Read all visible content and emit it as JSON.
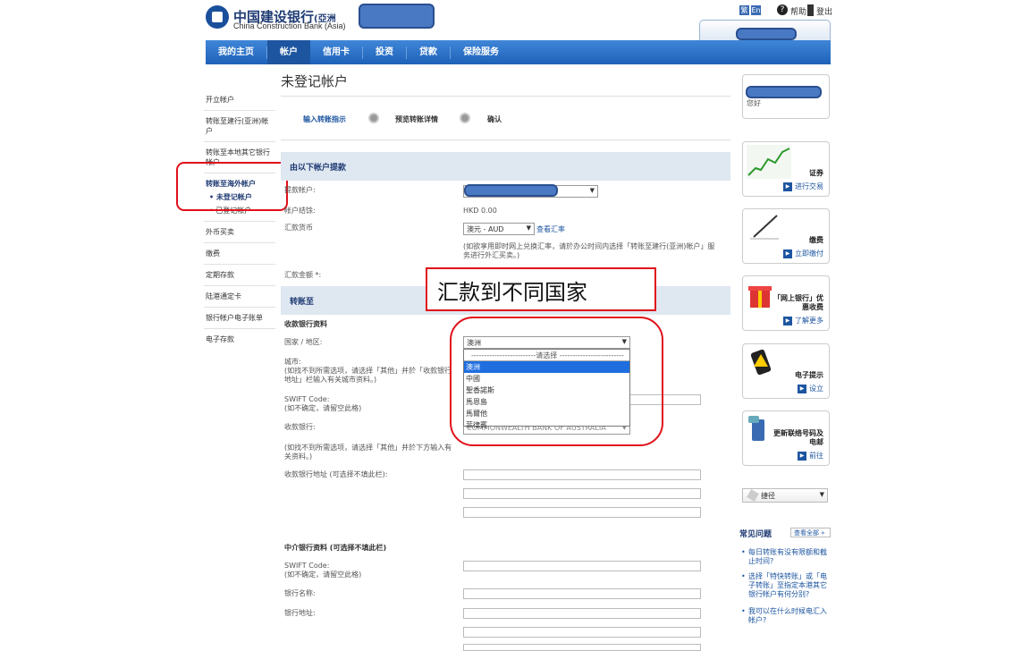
{
  "header": {
    "logo_cn": "中国建设银行",
    "logo_region": "(亞洲",
    "logo_en": "China Construction Bank (Asia)",
    "lang": [
      "繁",
      "En"
    ],
    "help": "帮助",
    "logout": "登出"
  },
  "nav": [
    "我的主页",
    "帐户",
    "信用卡",
    "投资",
    "贷款",
    "保险服务"
  ],
  "page_title": "未登记帐户",
  "sidebar": {
    "items": [
      "开立帐户",
      "转账至建行(亚洲)帐户",
      "转账至本地其它银行帐户",
      "转账至海外帐户"
    ],
    "subitems": [
      "未登记帐户",
      "已登记帐户"
    ],
    "items2": [
      "外币买卖",
      "缴费",
      "定期存款",
      "陆港通定卡",
      "银行帐户电子账单",
      "电子存款"
    ]
  },
  "steps": [
    "输入转账指示",
    "预览转账详情",
    "确认"
  ],
  "sec1": {
    "title": "由以下帐户提款",
    "debit_label": "提款帐户:",
    "balance_label": "帐户结馀:",
    "balance_value": "HKD 0.00",
    "currency_label": "汇款货币",
    "currency_value": "澳元 - AUD",
    "rate_link": "查看汇率",
    "currency_note": "(如欲享用即时网上兑换汇率，请於办公时间内选择「转账至建行(亚洲)帐户」服务进行外汇买卖。)",
    "amount_label": "汇款金额 *:"
  },
  "sec2": {
    "title": "转账至",
    "bank_info_title": "收款银行资料",
    "country_label": "国家 / 地区:",
    "country_value": "澳洲",
    "city_label": "城市:",
    "city_note": "(如找不到所需选项，请选择「其他」并於「收款银行地址」栏输入有关城市资料。)",
    "swift_label": "SWIFT Code:",
    "swift_note": "(如不确定，请留空此格)",
    "bank_label": "收款银行:",
    "bank_value": "COMMONWEALTH BANK OF AUSTRALIA",
    "bank_note": "(如找不到所需选项，请选择「其他」并於下方输入有关资料。)",
    "addr_label": "收款银行地址 (可选择不填此栏):",
    "inter_title": "中介银行资料 (可选择不填此栏)",
    "inter_swift_label": "SWIFT Code:",
    "inter_swift_note": "(如不确定，请留空此格)",
    "inter_name_label": "银行名称:",
    "inter_addr_label": "银行地址:"
  },
  "dropdown": {
    "placeholder": "-------------------------请选择 -------------------------",
    "options": [
      "澳洲",
      "中國",
      "聖香諾斯",
      "馬恩島",
      "馬爾他",
      "菲律賓"
    ],
    "highlighted": "澳洲"
  },
  "annotation": "汇款到不同国家",
  "right": {
    "greeting": "您好",
    "boxes": [
      {
        "title": "证券",
        "action": "进行交易"
      },
      {
        "title": "缴费",
        "action": "立即缴付"
      },
      {
        "title": "「网上银行」优惠收费",
        "action": "了解更多"
      },
      {
        "title": "电子提示",
        "action": "设立"
      },
      {
        "title": "更新联络号码及电邮",
        "action": "前往"
      }
    ],
    "shortcut": "捷径",
    "faq_title": "常见问题",
    "faq_more": "查看全部",
    "faq": [
      "每日转账有没有限额和截止时间?",
      "选择「特快转账」或「电子转账」至指定本港其它银行帐户有何分别?",
      "我可以在什么时候电汇入帐户?"
    ]
  },
  "colors": {
    "brand": "#1d55a0",
    "highlight": "#e0101a",
    "redaction": "#4a79c4"
  }
}
